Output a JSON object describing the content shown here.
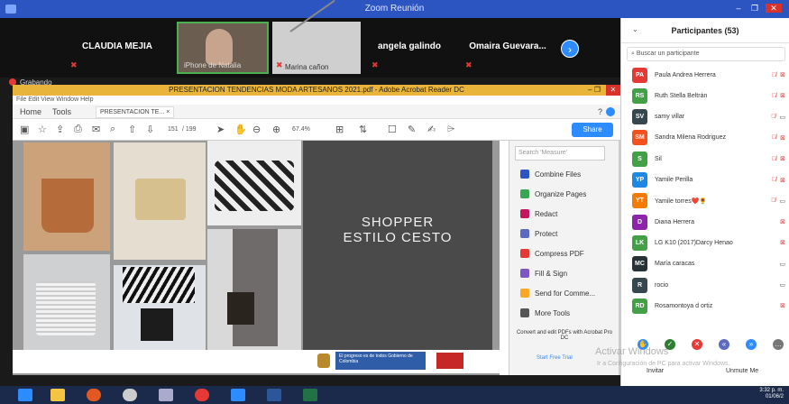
{
  "zoom": {
    "window_title": "Zoom Reunión",
    "recording": "Grabando",
    "video_tiles": [
      {
        "name": "CLAUDIA MEJIA"
      },
      {
        "name": "",
        "sub": "iPhone de Natalia"
      },
      {
        "name": "",
        "sub": "Marina cañon"
      },
      {
        "name": "angela galindo"
      },
      {
        "name": "Omaira Guevara..."
      }
    ]
  },
  "acrobat": {
    "title": "PRESENTACION TENDENCIAS MODA ARTESANOS 2021.pdf - Adobe Acrobat Reader DC",
    "menu": "File Edit View Window Help",
    "tabs": {
      "home": "Home",
      "tools": "Tools",
      "doc": "PRESENTACION TE... ×"
    },
    "toolbar": {
      "page_current": "151",
      "page_sep": "/ 199",
      "zoom": "67.4%",
      "share": "Share"
    },
    "slide": {
      "line1": "SHOPPER",
      "line2": "ESTILO CESTO"
    },
    "footer_badge": "El progreso es de todos   Gobierno de Colombia",
    "tools_search_placeholder": "Search 'Measure'",
    "tools": [
      {
        "label": "Combine Files",
        "color": "#2d55c2"
      },
      {
        "label": "Organize Pages",
        "color": "#3aa655"
      },
      {
        "label": "Redact",
        "color": "#c2185b"
      },
      {
        "label": "Protect",
        "color": "#5c6bc0"
      },
      {
        "label": "Compress PDF",
        "color": "#e53935"
      },
      {
        "label": "Fill & Sign",
        "color": "#7e57c2"
      },
      {
        "label": "Send for Comme...",
        "color": "#f9a825"
      },
      {
        "label": "More Tools",
        "color": "#555555"
      }
    ],
    "promo": "Convert and edit PDFs with Acrobat Pro DC",
    "free_trial": "Start Free Trial"
  },
  "participants": {
    "title": "Participantes (53)",
    "search_placeholder": "Buscar un participante",
    "list": [
      {
        "initials": "PA",
        "name": "Paula Andrea Herrera",
        "color": "#e53935",
        "muted": true,
        "video_off": true
      },
      {
        "initials": "RS",
        "name": "Ruth Stella Beltrán",
        "color": "#43a047",
        "muted": true,
        "video_off": true
      },
      {
        "initials": "SV",
        "name": "samy villar",
        "color": "#37474f",
        "muted": true,
        "video_off": false
      },
      {
        "initials": "SM",
        "name": "Sandra Milena Rodriguez",
        "color": "#f4511e",
        "muted": true,
        "video_off": true
      },
      {
        "initials": "S",
        "name": "Sil",
        "color": "#43a047",
        "muted": true,
        "video_off": true
      },
      {
        "initials": "YP",
        "name": "Yamile Perilla",
        "color": "#1e88e5",
        "muted": true,
        "video_off": true
      },
      {
        "initials": "YT",
        "name": "Yamile torres❤️🌻",
        "color": "#f57c00",
        "muted": true,
        "video_off": false
      },
      {
        "initials": "D",
        "name": "Diana Herrera",
        "color": "#8e24aa",
        "muted": false,
        "video_off": true
      },
      {
        "initials": "LK",
        "name": "LG K10 (2017)Darcy Henao",
        "color": "#43a047",
        "muted": false,
        "video_off": true
      },
      {
        "initials": "MC",
        "name": "María caracas",
        "color": "#263238",
        "muted": false,
        "video_off": false
      },
      {
        "initials": "R",
        "name": "rocio",
        "color": "#37474f",
        "muted": false,
        "video_off": false
      },
      {
        "initials": "RD",
        "name": "Rosamontoya d ortiz",
        "color": "#43a047",
        "muted": false,
        "video_off": true
      }
    ],
    "invite": "Invitar",
    "unmute": "Unmute Me"
  },
  "windows_watermark": {
    "line1": "Activar Windows",
    "line2": "Ir a Configuración de PC para activar Windows."
  },
  "taskbar": {
    "time": "3:32 p. m.",
    "date": "01/06/2"
  }
}
